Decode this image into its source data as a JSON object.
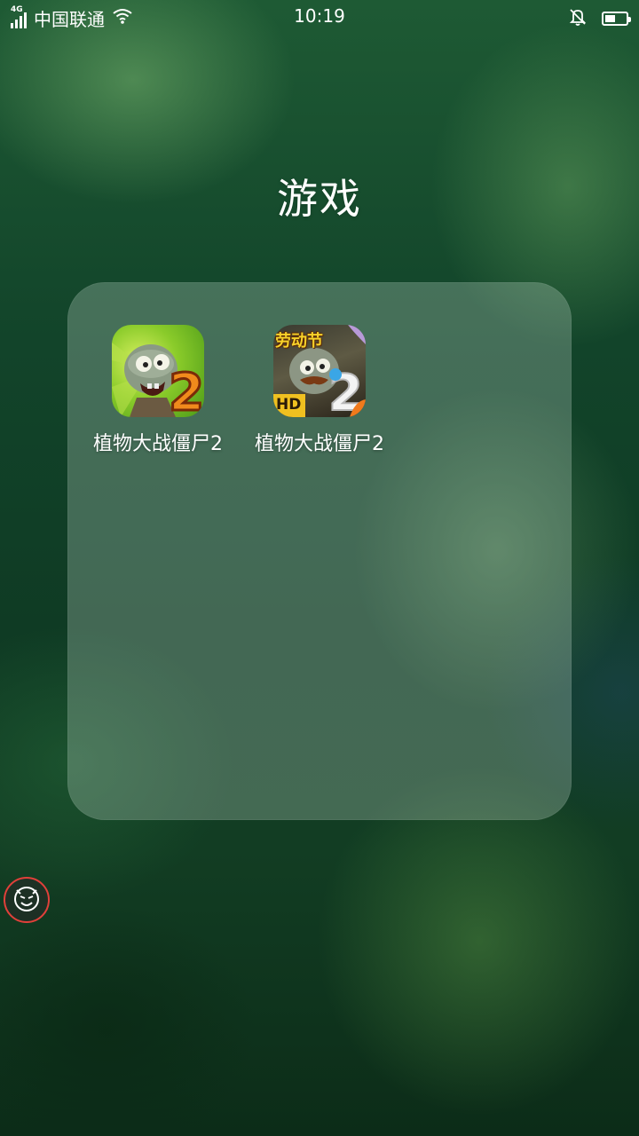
{
  "status_bar": {
    "network_type": "4G",
    "carrier": "中国联通",
    "time": "10:19",
    "battery_level": 0.5,
    "icons": [
      "signal-icon",
      "wifi-icon",
      "mute-bell-icon",
      "battery-icon"
    ]
  },
  "folder": {
    "title": "游戏",
    "apps": [
      {
        "label": "植物大战僵尸2",
        "icon": "pvz2-icon"
      },
      {
        "label": "植物大战僵尸2",
        "icon": "pvz2-hd-labor-day-icon",
        "badge_text": "劳动节",
        "hd_text": "HD"
      }
    ]
  },
  "floating_button": {
    "icon": "devil-face-icon"
  },
  "colors": {
    "panel_bg": "rgba(215,235,225,0.26)",
    "accent_red": "#e0403a",
    "text": "#ffffff"
  }
}
